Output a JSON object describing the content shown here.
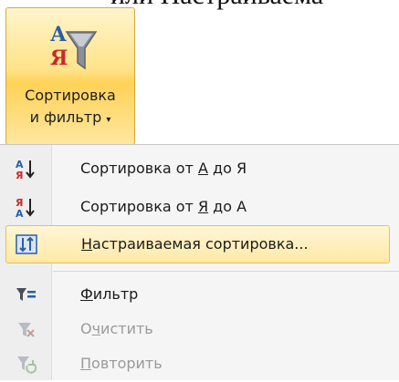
{
  "background_text": "или Настраиваема",
  "ribbon_button": {
    "label_line1": "Сортировка",
    "label_line2": "и фильтр",
    "dropdown_glyph": "▾",
    "icon": "sort-filter-icon"
  },
  "menu": {
    "items": [
      {
        "label_pre": "Сортировка от ",
        "label_key": "А",
        "label_post": " до Я",
        "icon": "sort-az-icon",
        "enabled": true
      },
      {
        "label_pre": "Сортировка от ",
        "label_key": "Я",
        "label_post": " до А",
        "icon": "sort-za-icon",
        "enabled": true
      },
      {
        "label_pre": "",
        "label_key": "Н",
        "label_post": "астраиваемая сортировка...",
        "icon": "custom-sort-icon",
        "enabled": true,
        "highlighted": true
      },
      {
        "label_pre": "",
        "label_key": "Ф",
        "label_post": "ильтр",
        "icon": "filter-icon",
        "enabled": true
      },
      {
        "label_pre": "О",
        "label_key": "ч",
        "label_post": "истить",
        "icon": "clear-filter-icon",
        "enabled": false
      },
      {
        "label_pre": "",
        "label_key": "П",
        "label_post": "овторить",
        "icon": "reapply-icon",
        "enabled": false
      }
    ]
  },
  "colors": {
    "highlight_fill": "#ffe9a6",
    "highlight_border": "#e7c05a",
    "sort_icon_red": "#c8292b",
    "sort_icon_blue": "#2a5ea8",
    "disabled_text": "#9a9a9a"
  }
}
